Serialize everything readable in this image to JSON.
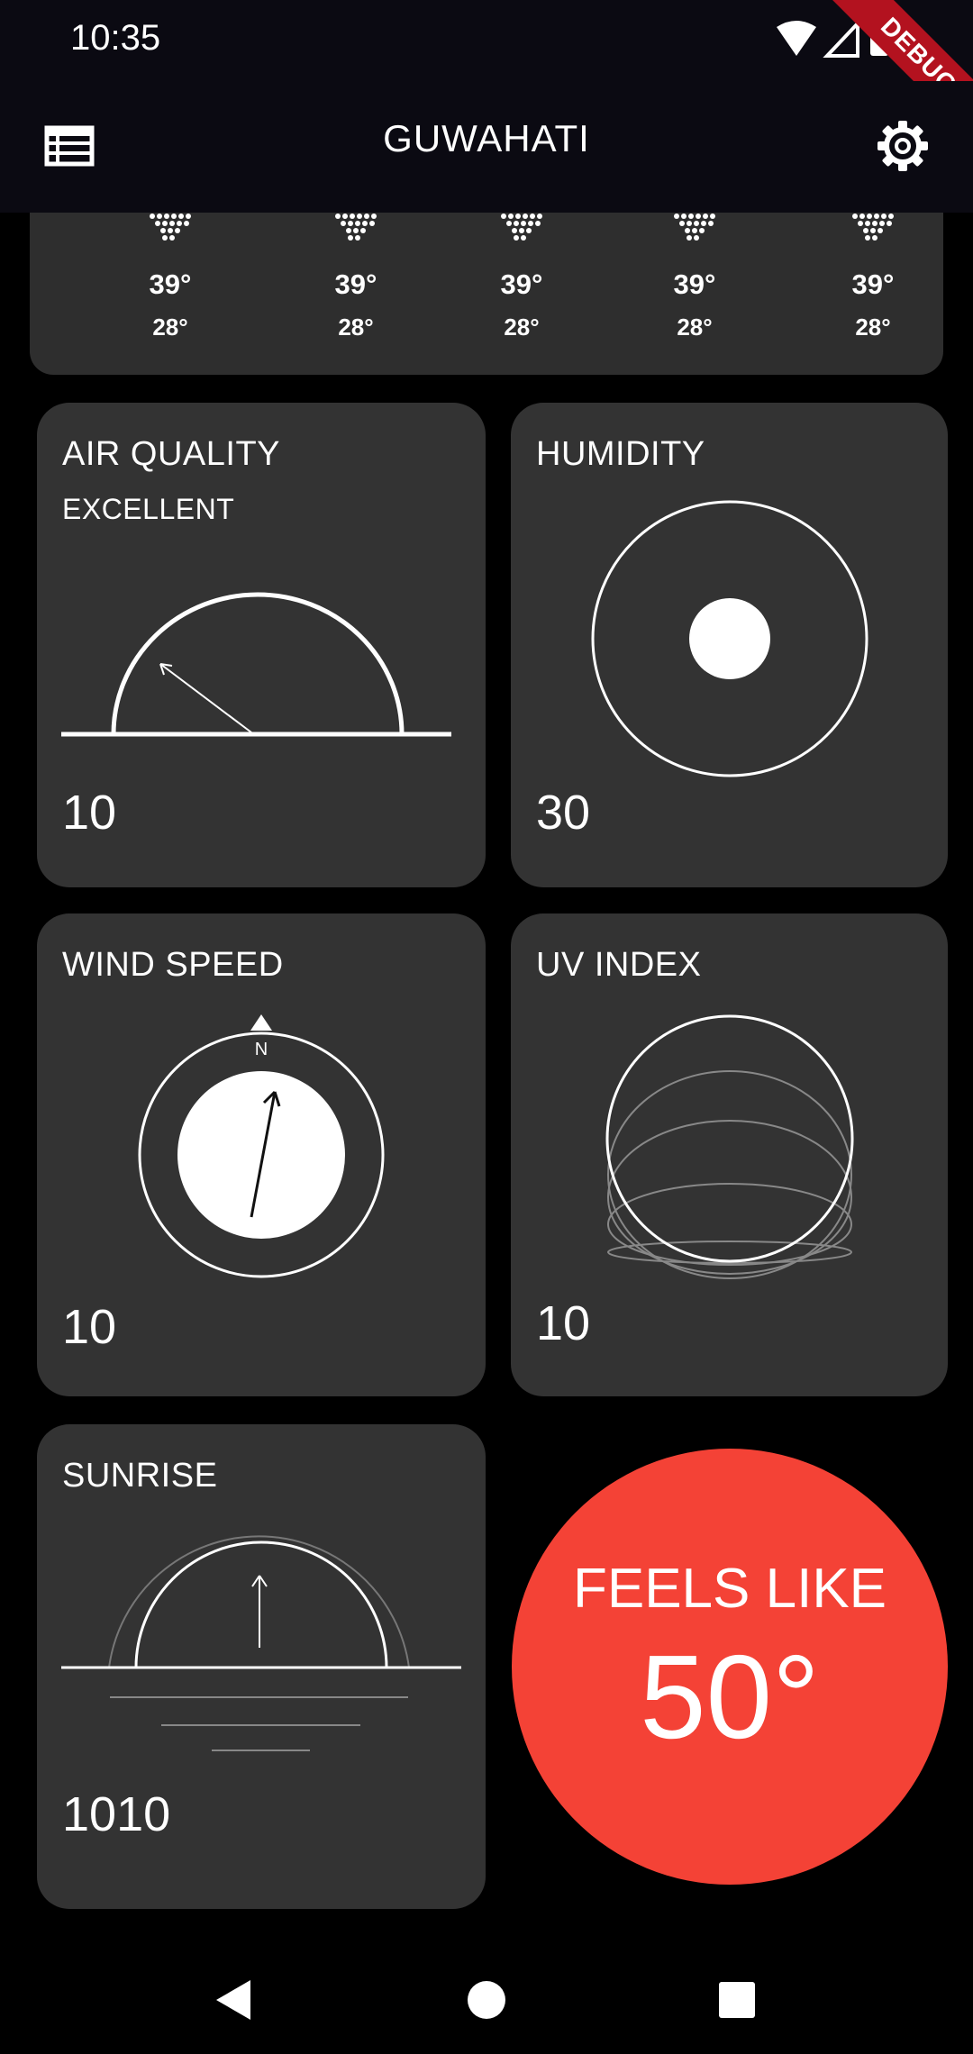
{
  "status_bar": {
    "time": "10:35",
    "debug_banner": "DEBUG"
  },
  "app_bar": {
    "title": "GUWAHATI",
    "menu_icon": "list-icon",
    "settings_icon": "gear-icon"
  },
  "forecast": [
    {
      "high": "39°",
      "low": "28°",
      "icon": "snow-icon"
    },
    {
      "high": "39°",
      "low": "28°",
      "icon": "snow-icon"
    },
    {
      "high": "39°",
      "low": "28°",
      "icon": "snow-icon"
    },
    {
      "high": "39°",
      "low": "28°",
      "icon": "snow-icon"
    },
    {
      "high": "39°",
      "low": "28°",
      "icon": "snow-icon"
    }
  ],
  "cards": {
    "air_quality": {
      "title": "AIR QUALITY",
      "status": "EXCELLENT",
      "value": "10"
    },
    "humidity": {
      "title": "HUMIDITY",
      "value": "30"
    },
    "wind_speed": {
      "title": "WIND SPEED",
      "compass_label": "N",
      "value": "10"
    },
    "uv_index": {
      "title": "UV INDEX",
      "value": "10"
    },
    "sunrise": {
      "title": "SUNRISE",
      "value": "1010"
    }
  },
  "feels_like": {
    "label": "FEELS LIKE",
    "value": "50°",
    "color": "#f44236"
  },
  "nav_bar": {
    "back": "back-icon",
    "home": "home-icon",
    "recents": "recents-icon"
  }
}
